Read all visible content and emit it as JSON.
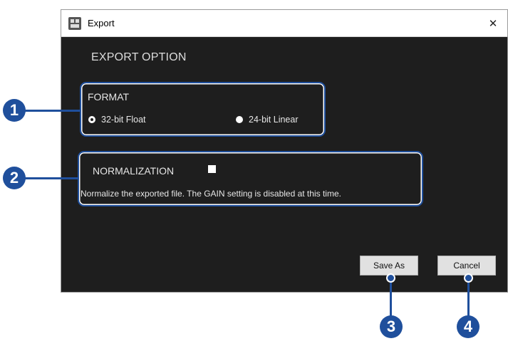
{
  "window": {
    "title": "Export",
    "close_glyph": "✕"
  },
  "dialog": {
    "section_title": "EXPORT OPTION",
    "format": {
      "label": "FORMAT",
      "options": [
        {
          "label": "32-bit Float",
          "selected": true
        },
        {
          "label": "24-bit Linear",
          "selected": false
        }
      ]
    },
    "normalization": {
      "label": "NORMALIZATION",
      "checked": false,
      "description": "Normalize the exported file. The GAIN setting is disabled at this time."
    },
    "buttons": {
      "save_as": "Save As",
      "cancel": "Cancel"
    }
  },
  "annotations": [
    "1",
    "2",
    "3",
    "4"
  ],
  "colors": {
    "dialog_bg": "#1e1e1e",
    "annotation": "#1f4f9c"
  }
}
